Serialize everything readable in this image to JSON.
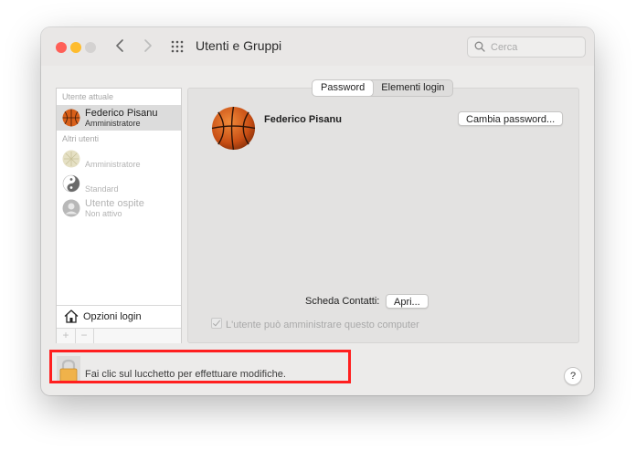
{
  "window": {
    "title": "Utenti e Gruppi",
    "search": {
      "placeholder": "Cerca",
      "value": ""
    }
  },
  "sidebar": {
    "current_user_header": "Utente attuale",
    "current_user": {
      "name": "Federico Pisanu",
      "role": "Amministratore"
    },
    "other_users_header": "Altri utenti",
    "other_users": [
      {
        "name": "",
        "role": "Amministratore"
      },
      {
        "name": "",
        "role": "Standard"
      },
      {
        "name": "Utente ospite",
        "role": "Non attivo"
      }
    ],
    "login_options_label": "Opzioni login",
    "add_label": "+",
    "remove_label": "−"
  },
  "content": {
    "tabs": [
      {
        "label": "Password",
        "active": true
      },
      {
        "label": "Elementi login",
        "active": false
      }
    ],
    "full_name": "Federico Pisanu",
    "change_password_label": "Cambia password...",
    "contacts_label": "Scheda Contatti:",
    "open_label": "Apri...",
    "admin_checkbox_label": "L'utente può amministrare questo computer"
  },
  "footer": {
    "lock_text": "Fai clic sul lucchetto per effettuare modifiche.",
    "help_label": "?"
  },
  "colors": {
    "highlight": "#ff1f1f",
    "basketball": "#e06a1e"
  }
}
